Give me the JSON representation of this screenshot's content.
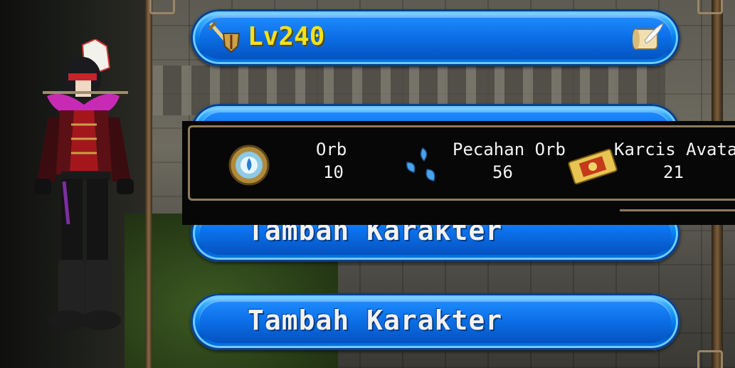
{
  "level": {
    "label": "Lv240"
  },
  "slots": [
    {
      "label": "Tambah Karakter"
    },
    {
      "label": "Tambah Karakter"
    }
  ],
  "currencies": [
    {
      "label": "Orb",
      "value": "10"
    },
    {
      "label": "Pecahan Orb",
      "value": "56"
    },
    {
      "label": "Karcis Avatar",
      "value": "21"
    }
  ],
  "colors": {
    "button_blue": "#0a86f0",
    "level_yellow": "#f2e11c",
    "frame_gold": "#8d7a5c"
  },
  "icons": {
    "level": "sword-shield-icon",
    "scroll": "scroll-feather-icon",
    "orb": "orb-icon",
    "orb_shards": "orb-shards-icon",
    "avatar_ticket": "avatar-ticket-icon"
  }
}
